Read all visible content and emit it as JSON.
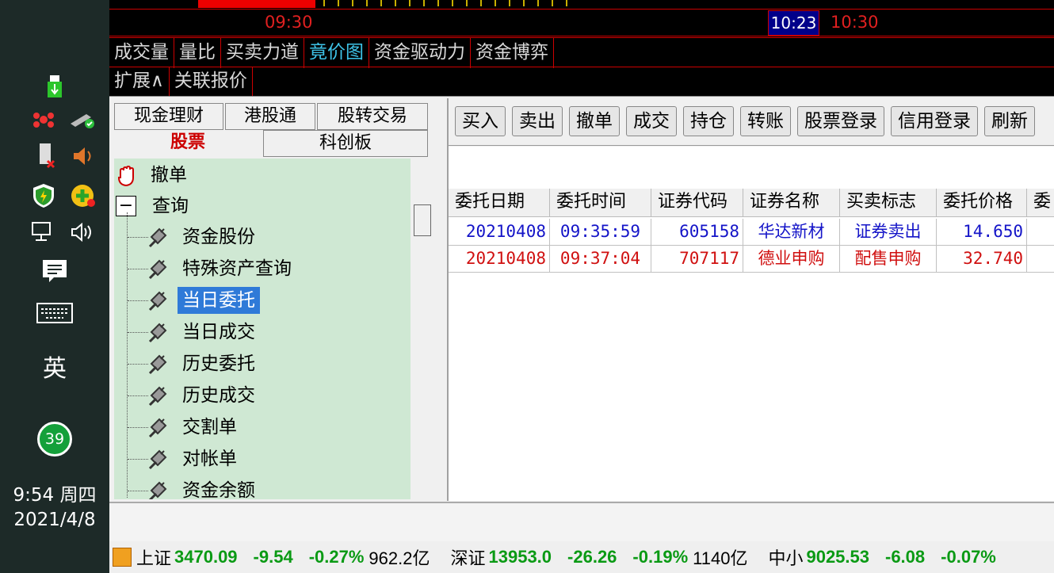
{
  "taskbar": {
    "language": "英",
    "badge_count": "39",
    "time": "9:54 周四",
    "date": "2021/4/8"
  },
  "chart": {
    "time_start": "09:30",
    "time_cursor": "10:23",
    "time_next": "10:30"
  },
  "indicator_tabs": [
    "成交量",
    "量比",
    "买卖力道",
    "竟价图",
    "资金驱动力",
    "资金博弈"
  ],
  "indicator_active": "竟价图",
  "extra_tabs": [
    "扩展∧",
    "关联报价"
  ],
  "left_tabs": {
    "cash": "现金理财",
    "hk": "港股通",
    "transfer": "股转交易",
    "stock": "股票",
    "star": "科创板"
  },
  "tree": {
    "cancel": "撤单",
    "query": "查询",
    "items": [
      "资金股份",
      "特殊资产查询",
      "当日委托",
      "当日成交",
      "历史委托",
      "历史成交",
      "交割单",
      "对帐单",
      "资金余额"
    ],
    "selected": "当日委托"
  },
  "toolbar": [
    "买入",
    "卖出",
    "撤单",
    "成交",
    "持仓",
    "转账",
    "股票登录",
    "信用登录",
    "刷新"
  ],
  "table": {
    "columns": [
      "委托日期",
      "委托时间",
      "证券代码",
      "证券名称",
      "买卖标志",
      "委托价格",
      "委"
    ],
    "rows": [
      {
        "date": "20210408",
        "time": "09:35:59",
        "code": "605158",
        "name": "华达新材",
        "side": "证券卖出",
        "price": "14.650",
        "color": "#1414c8"
      },
      {
        "date": "20210408",
        "time": "09:37:04",
        "code": "707117",
        "name": "德业申购",
        "side": "配售申购",
        "price": "32.740",
        "color": "#d01010"
      }
    ]
  },
  "ticker": {
    "sh_name": "上证",
    "sh_value": "3470.09",
    "sh_change": "-9.54",
    "sh_pct": "-0.27%",
    "sh_vol": "962.2亿",
    "sz_name": "深证",
    "sz_value": "13953.0",
    "sz_change": "-26.26",
    "sz_pct": "-0.19%",
    "sz_vol": "1140亿",
    "zx_name": "中小",
    "zx_value": "9025.53",
    "zx_change": "-6.08",
    "zx_pct": "-0.07%"
  }
}
